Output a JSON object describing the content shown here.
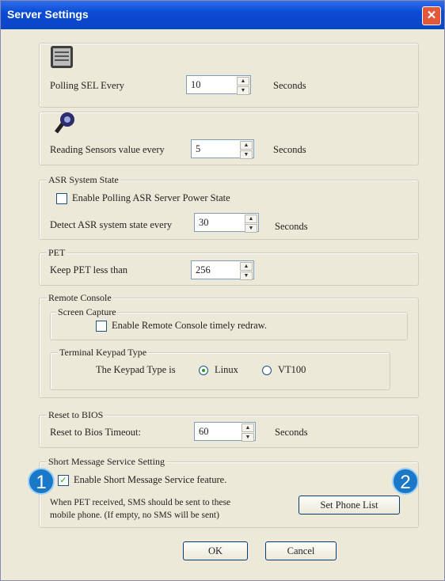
{
  "window": {
    "title": "Server Settings",
    "close_icon": "close-icon"
  },
  "sel": {
    "label": "Polling SEL Every",
    "value": "10",
    "unit": "Seconds",
    "icon": "event-log-icon"
  },
  "sensor": {
    "label": "Reading Sensors value every",
    "value": "5",
    "unit": "Seconds",
    "icon": "sensor-icon"
  },
  "asr": {
    "group_title": "ASR System State",
    "checkbox_label": "Enable Polling ASR Server Power State",
    "checked": false,
    "detect_label": "Detect ASR system state every",
    "value": "30",
    "unit": "Seconds"
  },
  "pet": {
    "group_title": "PET",
    "label": "Keep PET less than",
    "value": "256"
  },
  "remote_console": {
    "group_title": "Remote Console",
    "screen_capture": {
      "title": "Screen Capture",
      "checkbox_label": "Enable Remote Console timely redraw.",
      "checked": false
    },
    "keypad": {
      "title": "Terminal Keypad Type",
      "label": "The Keypad Type is",
      "options": [
        "Linux",
        "VT100"
      ],
      "selected": "Linux"
    }
  },
  "bios": {
    "group_title": "Reset to BIOS",
    "label": "Reset to Bios Timeout:",
    "value": "60",
    "unit": "Seconds"
  },
  "sms": {
    "group_title": "Short Message Service Setting",
    "checkbox_label": "Enable Short Message Service feature.",
    "checked": true,
    "note_line1": "When PET received, SMS should be sent to these",
    "note_line2": "mobile phone. (If empty, no SMS will be sent)",
    "phone_list_button": "Set Phone List"
  },
  "buttons": {
    "ok": "OK",
    "cancel": "Cancel"
  },
  "badges": {
    "one": "1",
    "two": "2"
  }
}
